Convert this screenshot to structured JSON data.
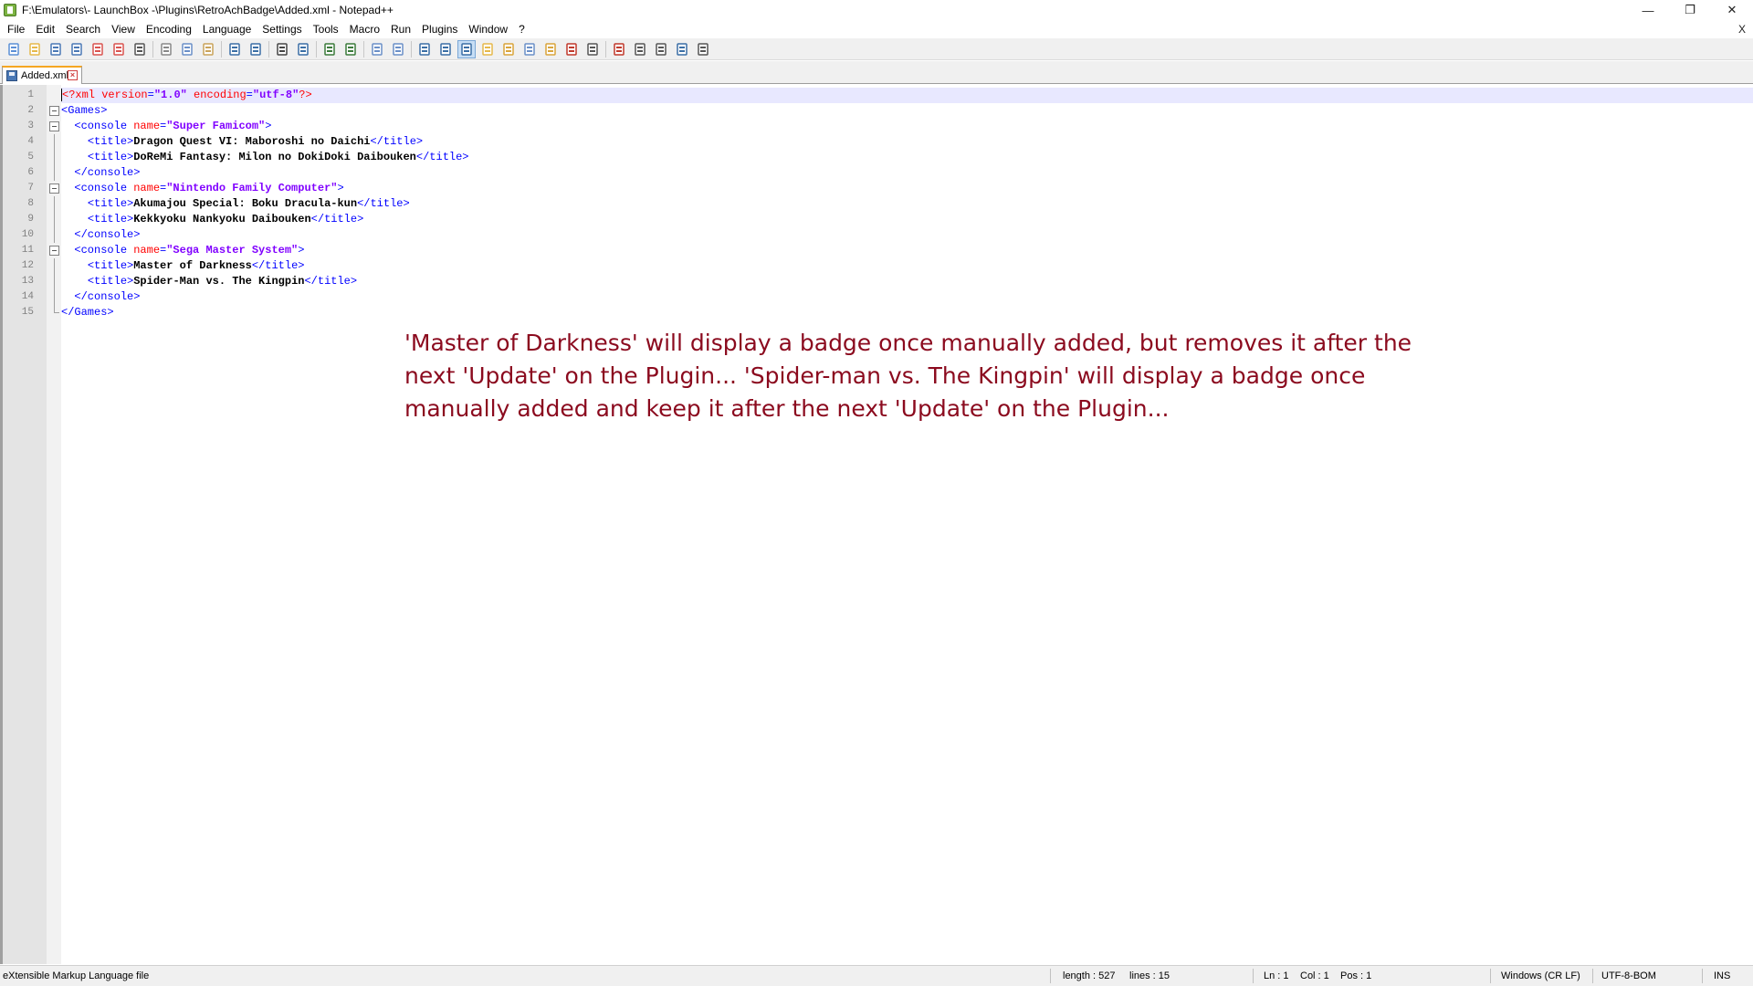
{
  "window": {
    "title": "F:\\Emulators\\- LaunchBox -\\Plugins\\RetroAchBadge\\Added.xml - Notepad++",
    "minimize": "—",
    "restore": "❐",
    "close": "✕"
  },
  "menu": {
    "items": [
      "File",
      "Edit",
      "Search",
      "View",
      "Encoding",
      "Language",
      "Settings",
      "Tools",
      "Macro",
      "Run",
      "Plugins",
      "Window",
      "?"
    ],
    "close_doc": "X"
  },
  "toolbar": {
    "icons": [
      "new-file-icon",
      "open-file-icon",
      "save-icon",
      "save-all-icon",
      "close-icon",
      "close-all-icon",
      "print-icon",
      "cut-icon",
      "copy-icon",
      "paste-icon",
      "undo-icon",
      "redo-icon",
      "find-icon",
      "replace-icon",
      "zoom-in-icon",
      "zoom-out-icon",
      "sync-vertical-icon",
      "sync-horizontal-icon",
      "word-wrap-icon",
      "show-all-chars-icon",
      "indent-guide-icon",
      "language-icon",
      "doc-map-icon",
      "function-list-icon",
      "folder-workspace-icon",
      "monitoring-icon",
      "preview-icon",
      "record-macro-icon",
      "stop-macro-icon",
      "play-macro-icon",
      "run-macro-multiple-icon",
      "save-macro-icon"
    ]
  },
  "tab": {
    "label": "Added.xml"
  },
  "editor": {
    "line_numbers": [
      "1",
      "2",
      "3",
      "4",
      "5",
      "6",
      "7",
      "8",
      "9",
      "10",
      "11",
      "12",
      "13",
      "14",
      "15"
    ],
    "lines": [
      {
        "indent": "",
        "parts": [
          {
            "c": "t-decl",
            "t": "<?xml "
          },
          {
            "c": "t-attr",
            "t": "version"
          },
          {
            "c": "t-tag",
            "t": "="
          },
          {
            "c": "t-val",
            "t": "\"1.0\""
          },
          {
            "c": "t-attr",
            "t": " encoding"
          },
          {
            "c": "t-tag",
            "t": "="
          },
          {
            "c": "t-val",
            "t": "\"utf-8\""
          },
          {
            "c": "t-decl",
            "t": "?>"
          }
        ]
      },
      {
        "indent": "",
        "parts": [
          {
            "c": "t-tag",
            "t": "<Games>"
          }
        ]
      },
      {
        "indent": "  ",
        "parts": [
          {
            "c": "t-tag",
            "t": "<console "
          },
          {
            "c": "t-attr",
            "t": "name"
          },
          {
            "c": "t-tag",
            "t": "="
          },
          {
            "c": "t-val",
            "t": "\"Super Famicom\""
          },
          {
            "c": "t-tag",
            "t": ">"
          }
        ]
      },
      {
        "indent": "    ",
        "parts": [
          {
            "c": "t-tag",
            "t": "<title>"
          },
          {
            "c": "t-text",
            "t": "Dragon Quest VI: Maboroshi no Daichi"
          },
          {
            "c": "t-tag",
            "t": "</title>"
          }
        ]
      },
      {
        "indent": "    ",
        "parts": [
          {
            "c": "t-tag",
            "t": "<title>"
          },
          {
            "c": "t-text",
            "t": "DoReMi Fantasy: Milon no DokiDoki Daibouken"
          },
          {
            "c": "t-tag",
            "t": "</title>"
          }
        ]
      },
      {
        "indent": "  ",
        "parts": [
          {
            "c": "t-tag",
            "t": "</console>"
          }
        ]
      },
      {
        "indent": "  ",
        "parts": [
          {
            "c": "t-tag",
            "t": "<console "
          },
          {
            "c": "t-attr",
            "t": "name"
          },
          {
            "c": "t-tag",
            "t": "="
          },
          {
            "c": "t-val",
            "t": "\"Nintendo Family Computer\""
          },
          {
            "c": "t-tag",
            "t": ">"
          }
        ]
      },
      {
        "indent": "    ",
        "parts": [
          {
            "c": "t-tag",
            "t": "<title>"
          },
          {
            "c": "t-text",
            "t": "Akumajou Special: Boku Dracula-kun"
          },
          {
            "c": "t-tag",
            "t": "</title>"
          }
        ]
      },
      {
        "indent": "    ",
        "parts": [
          {
            "c": "t-tag",
            "t": "<title>"
          },
          {
            "c": "t-text",
            "t": "Kekkyoku Nankyoku Daibouken"
          },
          {
            "c": "t-tag",
            "t": "</title>"
          }
        ]
      },
      {
        "indent": "  ",
        "parts": [
          {
            "c": "t-tag",
            "t": "</console>"
          }
        ]
      },
      {
        "indent": "  ",
        "parts": [
          {
            "c": "t-tag",
            "t": "<console "
          },
          {
            "c": "t-attr",
            "t": "name"
          },
          {
            "c": "t-tag",
            "t": "="
          },
          {
            "c": "t-val",
            "t": "\"Sega Master System\""
          },
          {
            "c": "t-tag",
            "t": ">"
          }
        ]
      },
      {
        "indent": "    ",
        "parts": [
          {
            "c": "t-tag",
            "t": "<title>"
          },
          {
            "c": "t-text",
            "t": "Master of Darkness"
          },
          {
            "c": "t-tag",
            "t": "</title>"
          }
        ]
      },
      {
        "indent": "    ",
        "parts": [
          {
            "c": "t-tag",
            "t": "<title>"
          },
          {
            "c": "t-text",
            "t": "Spider-Man vs. The Kingpin"
          },
          {
            "c": "t-tag",
            "t": "</title>"
          }
        ]
      },
      {
        "indent": "  ",
        "parts": [
          {
            "c": "t-tag",
            "t": "</console>"
          }
        ]
      },
      {
        "indent": "",
        "parts": [
          {
            "c": "t-tag",
            "t": "</Games>"
          }
        ]
      }
    ],
    "fold_markers": [
      "none",
      "open",
      "open",
      "line",
      "line",
      "line",
      "open",
      "line",
      "line",
      "line",
      "open",
      "line",
      "line",
      "line",
      "end"
    ]
  },
  "annotation": {
    "text": "'Master of Darkness' will display a badge once manually added, but removes it after the next 'Update' on the Plugin... 'Spider-man vs. The Kingpin' will display a badge once manually added and keep it after the next 'Update' on the Plugin..."
  },
  "statusbar": {
    "file_type": "eXtensible Markup Language file",
    "length": "length : 527",
    "lines": "lines : 15",
    "ln": "Ln : 1",
    "col": "Col : 1",
    "pos": "Pos : 1",
    "eol": "Windows (CR LF)",
    "encoding": "UTF-8-BOM",
    "mode": "INS"
  },
  "colors": {
    "annotation": "#8b0a1e",
    "tag": "#0000ff",
    "attribute": "#ff0000",
    "value": "#8000ff",
    "current_line": "#e8e8ff"
  }
}
